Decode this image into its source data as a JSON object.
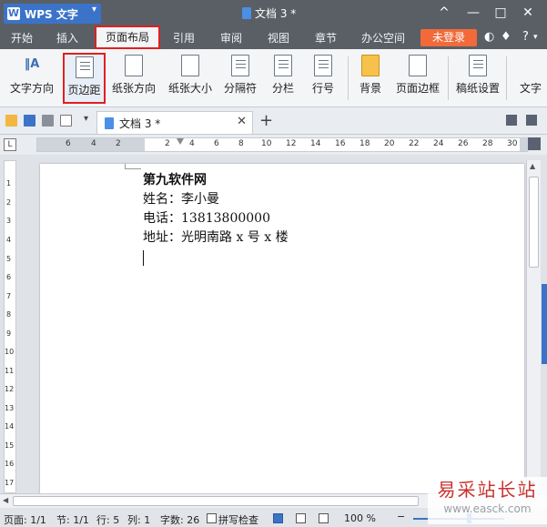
{
  "app": {
    "name": "WPS 文字",
    "logo": "W",
    "doc_title": "文档 3 *"
  },
  "window_controls": [
    "^",
    "—",
    "□",
    "✕"
  ],
  "menu": {
    "tabs": [
      "开始",
      "插入",
      "页面布局",
      "引用",
      "审阅",
      "视图",
      "章节",
      "办公空间"
    ],
    "active": "页面布局",
    "login": "未登录",
    "help": "?"
  },
  "ribbon": {
    "buttons": [
      {
        "label": "文字方向",
        "icon": "text-direction-icon"
      },
      {
        "label": "页边距",
        "icon": "margins-icon",
        "highlight": true
      },
      {
        "label": "纸张方向",
        "icon": "orientation-icon"
      },
      {
        "label": "纸张大小",
        "icon": "paper-size-icon"
      },
      {
        "label": "分隔符",
        "icon": "break-icon"
      },
      {
        "label": "分栏",
        "icon": "columns-icon"
      },
      {
        "label": "行号",
        "icon": "line-numbers-icon"
      },
      {
        "label": "背景",
        "icon": "background-icon"
      },
      {
        "label": "页面边框",
        "icon": "page-border-icon"
      },
      {
        "label": "稿纸设置",
        "icon": "grid-paper-icon"
      },
      {
        "label": "文字",
        "icon": "text-icon"
      }
    ]
  },
  "doc_tab": {
    "title": "文档 3 *"
  },
  "ruler": {
    "h_ticks": [
      "6",
      "4",
      "2",
      "2",
      "4",
      "6",
      "8",
      "10",
      "12",
      "14",
      "16",
      "18",
      "20",
      "22",
      "24",
      "26",
      "28",
      "30"
    ],
    "v_ticks": [
      "1",
      "2",
      "3",
      "4",
      "5",
      "6",
      "7",
      "8",
      "9",
      "10",
      "11",
      "12",
      "13",
      "14",
      "15",
      "16",
      "17"
    ]
  },
  "document": {
    "heading": "第九软件网",
    "lines": [
      "姓名：李小曼",
      "电话：13813800000",
      "地址：光明南路 x 号 x 楼"
    ]
  },
  "status": {
    "page": "页面: 1/1",
    "section": "节: 1/1",
    "row": "行: 5",
    "col": "列: 1",
    "words": "字数: 26",
    "spell": "拼写检查",
    "zoom": "100 %"
  },
  "watermark": {
    "cn": "易采站长站",
    "url": "www.easck.com"
  }
}
